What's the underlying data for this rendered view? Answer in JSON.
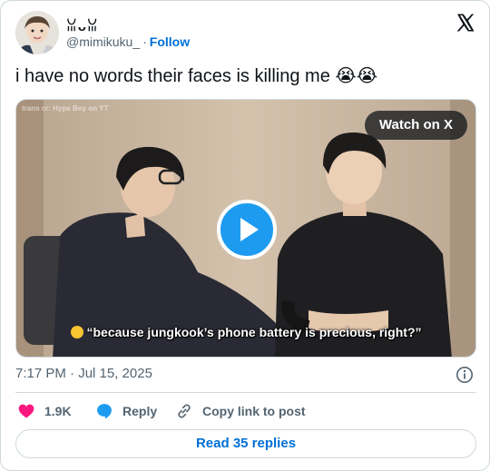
{
  "author": {
    "display_name": "ꈍᴗꈍ",
    "handle": "@mimikuku_",
    "separator": "·",
    "follow_label": "Follow"
  },
  "tweet": {
    "text": "i have no words their faces is killing me 😭😭",
    "timestamp": "7:17 PM · Jul 15, 2025"
  },
  "media": {
    "watermark": "trans cr: Hype Boy on YT",
    "watch_label": "Watch on X",
    "caption": "“because jungkook’s phone battery is precious, right?”"
  },
  "actions": {
    "like_count": "1.9K",
    "reply_label": "Reply",
    "copy_label": "Copy link to post"
  },
  "read_replies_label": "Read 35 replies",
  "colors": {
    "accent": "#1d9bf0",
    "link": "#006fd6",
    "like": "#f91880",
    "border": "#cfd9de",
    "secondary_text": "#536471"
  },
  "icons": [
    "x-logo-icon",
    "play-icon",
    "info-icon",
    "heart-icon",
    "reply-bubble-icon",
    "link-icon"
  ]
}
